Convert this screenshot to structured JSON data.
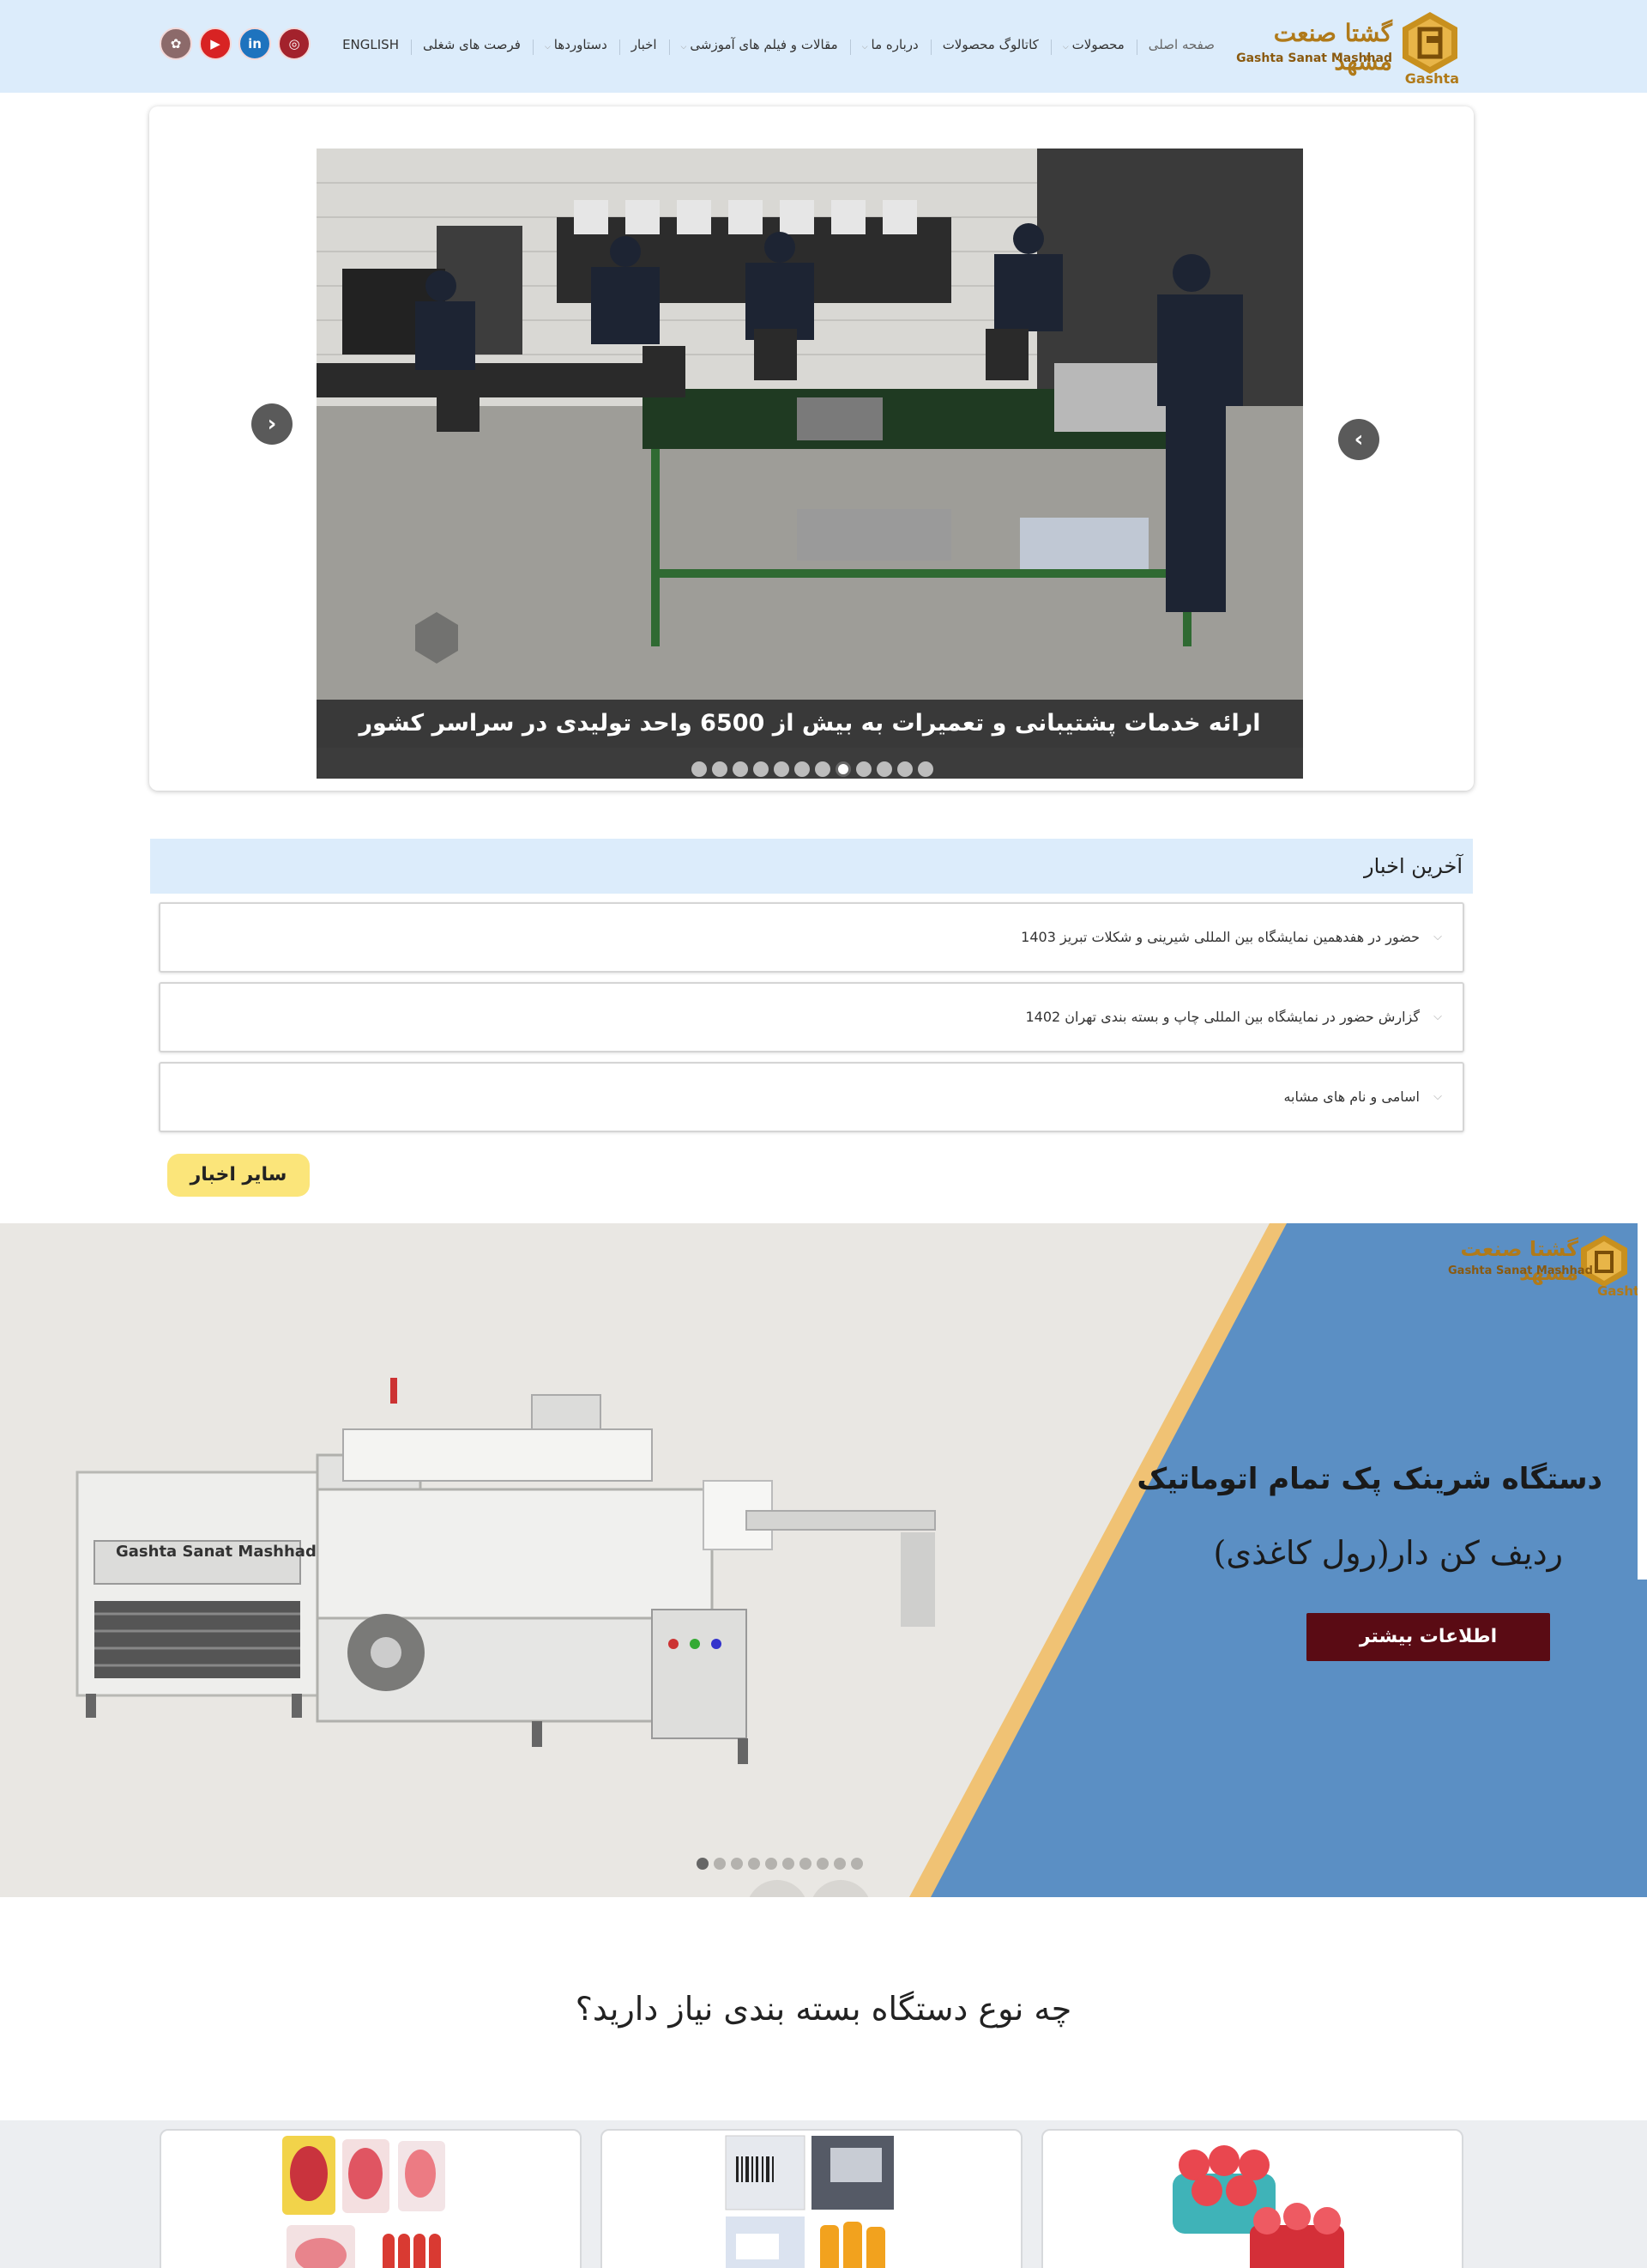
{
  "header": {
    "logo": {
      "name_fa": "گشتا صنعت مشهد",
      "name_en": "Gashta Sanat Mashhad",
      "brand": "Gashta"
    },
    "nav": [
      {
        "label": "صفحه اصلی",
        "active": true,
        "has_submenu": false
      },
      {
        "label": "محصولات",
        "active": false,
        "has_submenu": true
      },
      {
        "label": "کاتالوگ محصولات",
        "active": false,
        "has_submenu": false
      },
      {
        "label": "درباره ما",
        "active": false,
        "has_submenu": true
      },
      {
        "label": "مقالات و فیلم های آموزشی",
        "active": false,
        "has_submenu": true
      },
      {
        "label": "اخبار",
        "active": false,
        "has_submenu": false
      },
      {
        "label": "دستاوردها",
        "active": false,
        "has_submenu": true
      },
      {
        "label": "فرصت های شغلی",
        "active": false,
        "has_submenu": false
      },
      {
        "label": "ENGLISH",
        "active": false,
        "has_submenu": false
      }
    ],
    "socials": [
      {
        "name": "instagram-icon",
        "glyph": "◎",
        "color": "#a3222c"
      },
      {
        "name": "linkedin-icon",
        "glyph": "in",
        "color": "#1e73be"
      },
      {
        "name": "youtube-icon",
        "glyph": "▶",
        "color": "#d82323"
      },
      {
        "name": "aparat-icon",
        "glyph": "✿",
        "color": "#8c6a6a"
      }
    ]
  },
  "hero_slider": {
    "caption": "ارائه خدمات پشتیبانی و تعمیرات به بیش از 6500 واحد تولیدی در سراسر کشور",
    "slide_count": 12,
    "active_index": 7,
    "prev_icon": "chevron-left-icon",
    "next_icon": "chevron-right-icon"
  },
  "news": {
    "title": "آخرین اخبار",
    "items": [
      "حضور در هفدهمین نمایشگاه بین المللی شیرینی و شکلات تبریز 1403",
      "گزارش حضور در نمایشگاه بین المللی چاپ و بسته بندی تهران 1402",
      "اسامی و نام های مشابه"
    ],
    "more_label": "سایر اخبار"
  },
  "banner": {
    "title_line1": "دستگاه شرینک پک تمام اتوماتیک",
    "title_line2": "ردیف کن دار(رول کاغذی)",
    "button_label": "اطلاعات بیشتر",
    "machine_label": "Gashta Sanat Mashhad",
    "slide_count": 10,
    "active_index": 0,
    "colors": {
      "panel": "#5b8fc4",
      "stripe": "#f0c274",
      "button": "#5a0b14"
    }
  },
  "section": {
    "title": "چه نوع دستگاه بسته بندی نیاز دارید؟",
    "cards": [
      "food-trays-image",
      "labels-and-bottles-image",
      "bottle-packs-image"
    ]
  }
}
